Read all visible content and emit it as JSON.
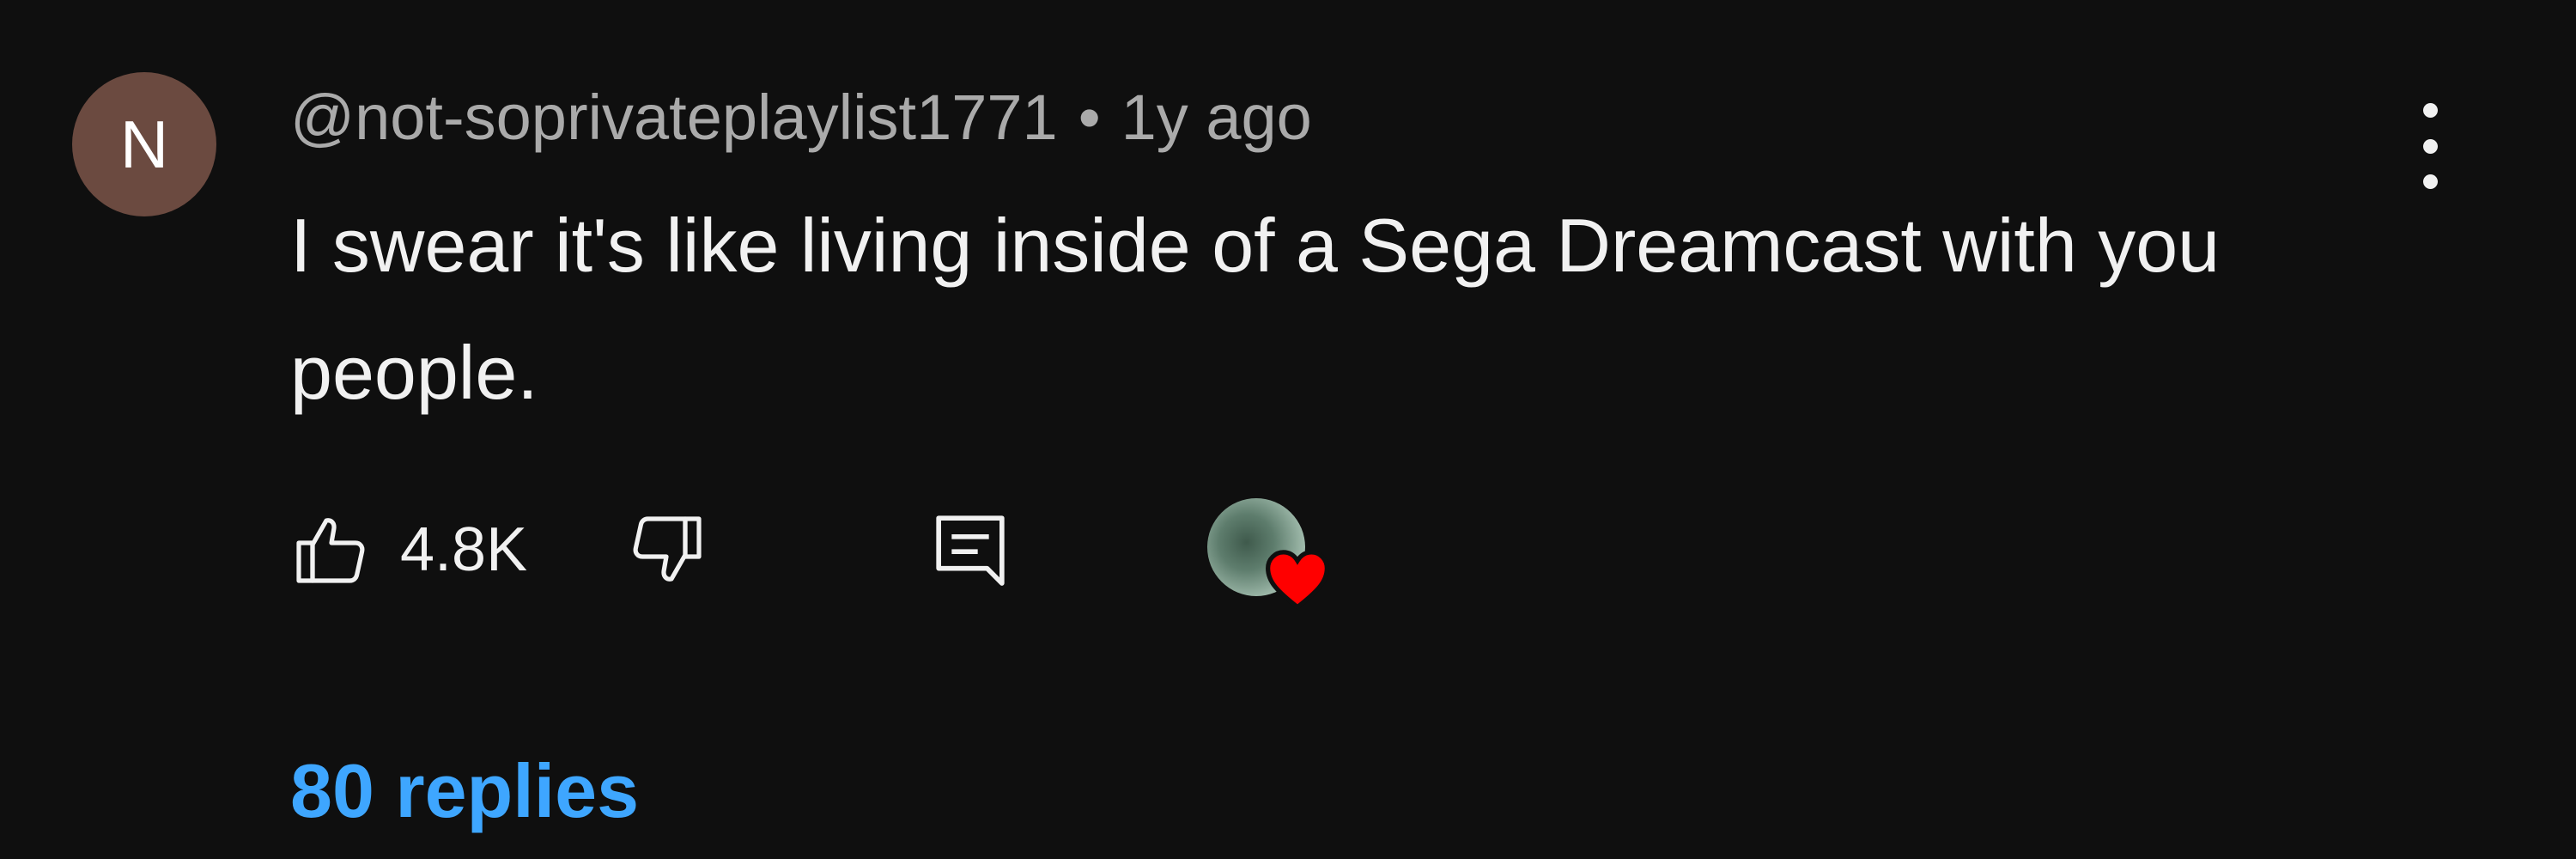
{
  "comment": {
    "avatar_initial": "N",
    "author": "@not-soprivateplaylist1771",
    "separator": "•",
    "time": "1y ago",
    "text": "I swear it's like living inside of a Sega Dreamcast with you people.",
    "like_count": "4.8K",
    "replies_label": "80 replies"
  },
  "colors": {
    "background": "#0f0f0f",
    "avatar": "#6b4a40",
    "meta_text": "#aaaaaa",
    "body_text": "#f1f1f1",
    "replies_link": "#3ea6ff",
    "heart": "#ff0000"
  },
  "icons": {
    "more": "more-vertical-icon",
    "like": "thumbs-up-icon",
    "dislike": "thumbs-down-icon",
    "reply": "reply-comment-icon",
    "creator_heart": "heart-icon"
  }
}
